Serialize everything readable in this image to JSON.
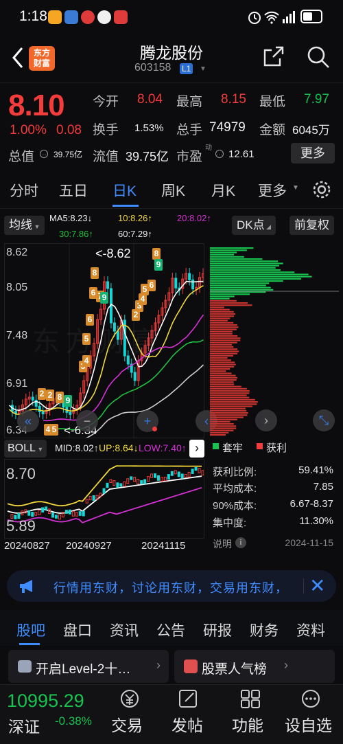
{
  "status_bar": {
    "time": "1:18",
    "battery": "51"
  },
  "header": {
    "logo_line1": "东方",
    "logo_line2": "财富",
    "stock_name": "腾龙股份",
    "stock_code": "603158",
    "level_badge": "L1"
  },
  "quote": {
    "price": "8.10",
    "change_pct": "1.00%",
    "change_amt": "0.08",
    "open_label": "今开",
    "open": "8.04",
    "high_label": "最高",
    "high": "8.15",
    "low_label": "最低",
    "low": "7.97",
    "turnover_label": "换手",
    "turnover": "1.53%",
    "volume_label": "总手",
    "volume": "74979",
    "amount_label": "金额",
    "amount": "6045万",
    "mktcap_label": "总值",
    "mktcap": "39.75亿",
    "float_label": "流值",
    "float": "39.75亿",
    "pe_label": "市盈",
    "pe_sup": "动",
    "pe": "12.61",
    "more_label": "更多"
  },
  "period_tabs": [
    "分时",
    "五日",
    "日K",
    "周K",
    "月K",
    "更多"
  ],
  "indicators": {
    "ma_button": "均线",
    "dk_button": "DK点",
    "adjust_button": "前复权",
    "ma5": "MA5:8.23↓",
    "ma10": "10:8.26↑",
    "ma20": "20:8.02↑",
    "ma30": "30:7.86↑",
    "ma60": "60:7.29↑"
  },
  "chart": {
    "y_labels": [
      "8.62",
      "8.05",
      "7.48",
      "6.91",
      "6.34"
    ],
    "high_marker": "<-8.62",
    "low_marker": "<-6.34",
    "watermark": "东方财富",
    "colors": {
      "up": "#f43c3c",
      "down": "#17d6d6",
      "ma5": "#ffffff",
      "ma10": "#f3d83c",
      "ma20": "#d431d4",
      "ma30": "#20c040",
      "ma60": "#cfcfcf"
    }
  },
  "chip_dist": {
    "profit_legend": "套牢",
    "loss_legend": "获利",
    "profit_ratio_label": "获利比例:",
    "profit_ratio": "59.41%",
    "avg_cost_label": "平均成本:",
    "avg_cost": "7.85",
    "cost90_label": "90%成本:",
    "cost90": "6.67-8.37",
    "concentration_label": "集中度:",
    "concentration": "11.30%",
    "explain_label": "说明",
    "date": "2024-11-15"
  },
  "boll": {
    "button": "BOLL",
    "mid": "MID:8.02↑",
    "up": "UP:8.64↓",
    "low": "LOW:7.40↑",
    "y_top": "8.70",
    "y_bottom": "5.89",
    "dates": [
      "20240827",
      "20240927",
      "20241115"
    ]
  },
  "banner": {
    "text": "行情用东财，讨论用东财，交易用东财，"
  },
  "news_tabs": [
    "股吧",
    "盘口",
    "资讯",
    "公告",
    "研报",
    "财务",
    "资料"
  ],
  "cards": [
    {
      "text": "开启Level-2十…"
    },
    {
      "text": "股票人气榜"
    }
  ],
  "bottom": {
    "index_value": "10995.29",
    "index_name": "深证",
    "index_change": "-0.38%",
    "buttons": [
      "交易",
      "发帖",
      "功能",
      "自选"
    ]
  }
}
